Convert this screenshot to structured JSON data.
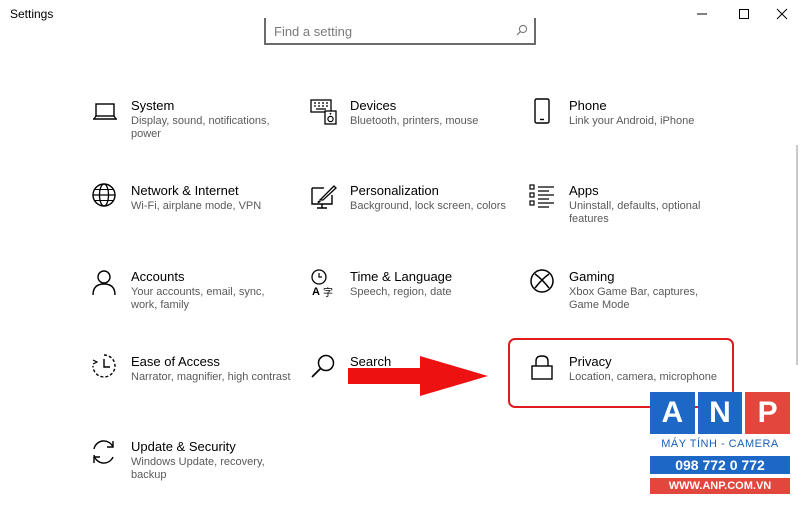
{
  "window": {
    "title": "Settings"
  },
  "search": {
    "placeholder": "Find a setting"
  },
  "tiles": [
    {
      "name": "System",
      "desc": "Display, sound, notifications, power",
      "icon": "laptop-icon"
    },
    {
      "name": "Devices",
      "desc": "Bluetooth, printers, mouse",
      "icon": "keyboard-speaker-icon"
    },
    {
      "name": "Phone",
      "desc": "Link your Android, iPhone",
      "icon": "phone-icon"
    },
    {
      "name": "Network & Internet",
      "desc": "Wi-Fi, airplane mode, VPN",
      "icon": "globe-icon"
    },
    {
      "name": "Personalization",
      "desc": "Background, lock screen, colors",
      "icon": "paintbrush-icon"
    },
    {
      "name": "Apps",
      "desc": "Uninstall, defaults, optional features",
      "icon": "apps-list-icon"
    },
    {
      "name": "Accounts",
      "desc": "Your accounts, email, sync, work, family",
      "icon": "person-icon"
    },
    {
      "name": "Time & Language",
      "desc": "Speech, region, date",
      "icon": "time-language-icon"
    },
    {
      "name": "Gaming",
      "desc": "Xbox Game Bar, captures, Game Mode",
      "icon": "xbox-icon"
    },
    {
      "name": "Ease of Access",
      "desc": "Narrator, magnifier, high contrast",
      "icon": "ease-of-access-icon"
    },
    {
      "name": "Search",
      "desc": "",
      "icon": "search-icon"
    },
    {
      "name": "Privacy",
      "desc": "Location, camera, microphone",
      "icon": "lock-icon"
    },
    {
      "name": "Update & Security",
      "desc": "Windows Update, recovery, backup",
      "icon": "update-icon"
    }
  ],
  "watermark": {
    "letters": [
      "A",
      "N",
      "P"
    ],
    "tagline": "MÁY TÍNH - CAMERA",
    "phone": "098 772 0 772",
    "website": "WWW.ANP.COM.VN",
    "colors": {
      "blue": "#1d68c6",
      "red": "#e3463c"
    }
  },
  "annotation": {
    "highlight_color": "#e11b1b",
    "arrow_color": "#ee1111"
  }
}
